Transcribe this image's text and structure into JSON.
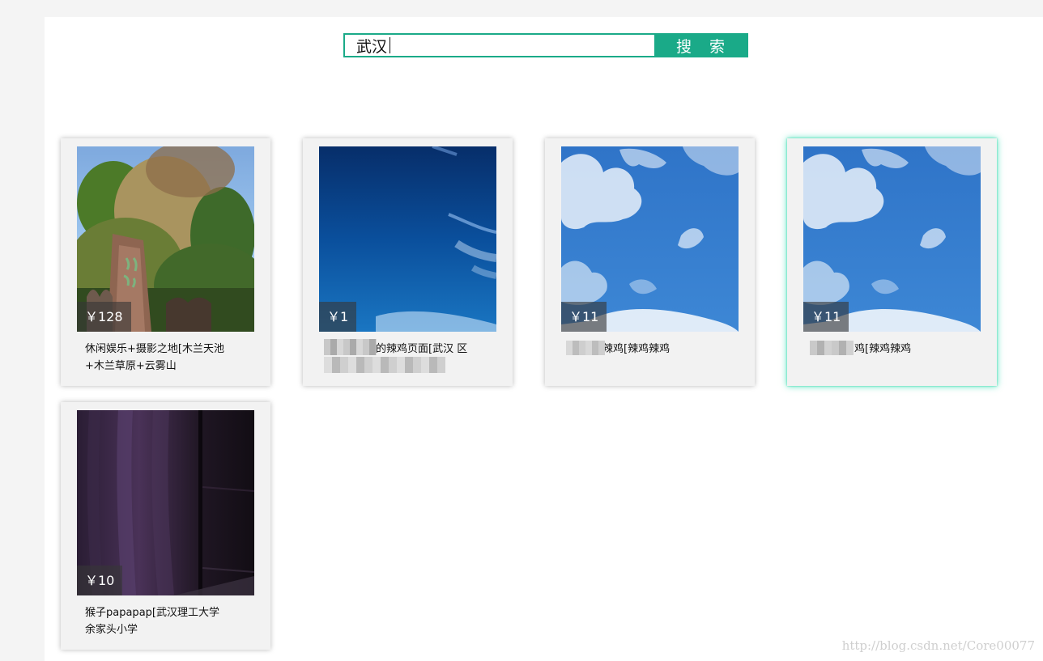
{
  "search": {
    "query": "武汉",
    "button_label": "搜 索"
  },
  "products": [
    {
      "price": "￥128",
      "title": "休闲娱乐+摄影之地[木兰天池+木兰草原+云雾山"
    },
    {
      "price": "￥1",
      "title": "的辣鸡页面[武汉 区"
    },
    {
      "price": "￥11",
      "title": "辣鸡[辣鸡辣鸡"
    },
    {
      "price": "￥11",
      "title": "鸡[辣鸡辣鸡"
    },
    {
      "price": "￥10",
      "title": "猴子papapap[武汉理工大学余家头小学"
    }
  ],
  "watermark": "http://blog.csdn.net/Core00077",
  "colors": {
    "accent": "#1aaa88",
    "card_bg": "#f2f2f2",
    "highlight_glow": "#1ad6a4"
  },
  "icons": {
    "text_cursor": "text-cursor-icon"
  }
}
